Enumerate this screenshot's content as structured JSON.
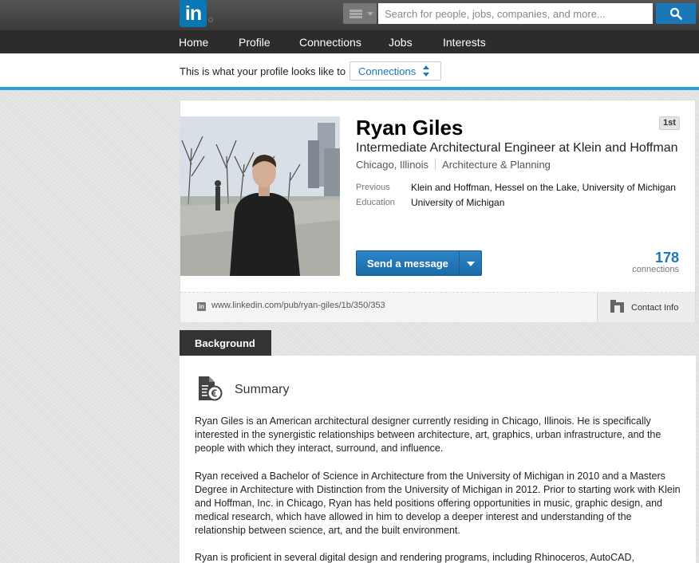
{
  "topbar": {
    "logo_text": "in",
    "search_placeholder": "Search for people, jobs, companies, and more..."
  },
  "nav": {
    "items": [
      {
        "label": "Home"
      },
      {
        "label": "Profile"
      },
      {
        "label": "Connections"
      },
      {
        "label": "Jobs"
      },
      {
        "label": "Interests"
      }
    ]
  },
  "viewas": {
    "label": "This is what your profile looks like to",
    "selected": "Connections"
  },
  "profile": {
    "name": "Ryan Giles",
    "degree_badge": "1st",
    "headline": "Intermediate Architectural Engineer at Klein and Hoffman",
    "location": "Chicago, Illinois",
    "industry": "Architecture & Planning",
    "previous_label": "Previous",
    "previous_value": "Klein and Hoffman, Hessel on the Lake, University of Michigan",
    "education_label": "Education",
    "education_value": "University of Michigan",
    "send_message_label": "Send a message",
    "connections_count": "178",
    "connections_label": "connections",
    "public_url": "www.linkedin.com/pub/ryan-giles/1b/350/353",
    "contact_info_label": "Contact Info"
  },
  "background": {
    "tab_label": "Background",
    "summary_title": "Summary",
    "paragraphs": [
      "Ryan Giles is an American architectural designer currently residing in Chicago, Illinois. He is specifically interested in the synergistic relationships between architecture, art, graphics, urban infrastructure, and the people with which they interact, surround, and influence.",
      "Ryan received a Bachelor of Science in Architecture from the University of Michigan in 2010 and a Masters Degree in Architecture with Distinction from the University of Michigan in 2012. Prior to starting work with Klein and Hoffman, Inc. in Chicago, Ryan has held positions offering opportunities in music, graphic design, and medical research, which have allowed in him to develop a deeper interest and understanding of the relationship between science, art, and the built environment.",
      "Ryan is proficient in several digital design and rendering programs, including Rhinoceros, AutoCAD,"
    ]
  },
  "colors": {
    "brand_blue": "#0a77b5",
    "link_blue": "#1a78b9",
    "accent_line": "#2aa0d6",
    "nav_bg": "#2c2c2c"
  }
}
